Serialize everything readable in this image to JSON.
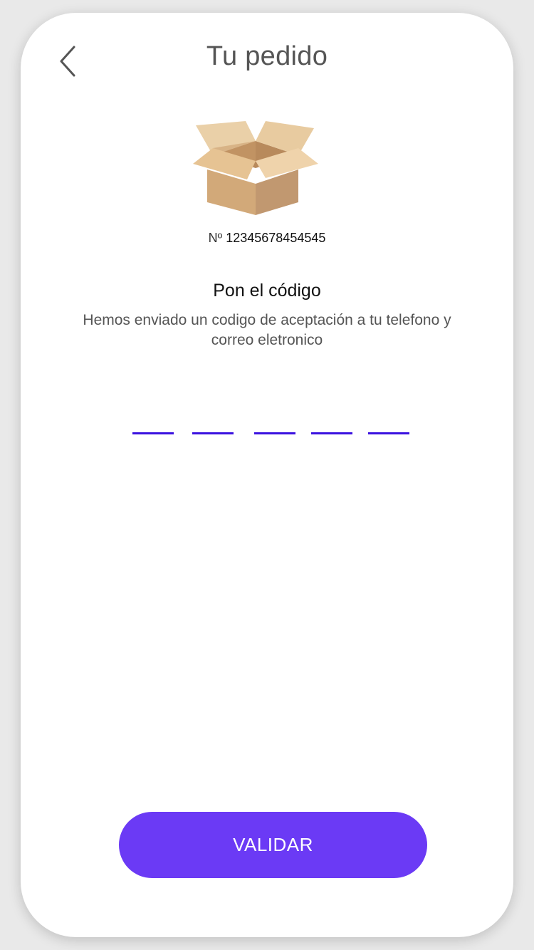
{
  "header": {
    "title": "Tu pedido",
    "back_icon": "chevron-left-icon"
  },
  "order": {
    "prefix": "Nº",
    "number": "12345678454545",
    "image_icon": "open-box-icon"
  },
  "code_section": {
    "heading": "Pon el código",
    "description": "Hemos enviado un codigo de aceptación a tu telefono y correo eletronico",
    "digit_count": 5
  },
  "actions": {
    "validate_label": "VALIDAR"
  },
  "colors": {
    "accent": "#6b3af5",
    "underline": "#3b12e0",
    "title": "#555555",
    "box_light": "#e8cba0",
    "box_dark": "#c19870"
  }
}
